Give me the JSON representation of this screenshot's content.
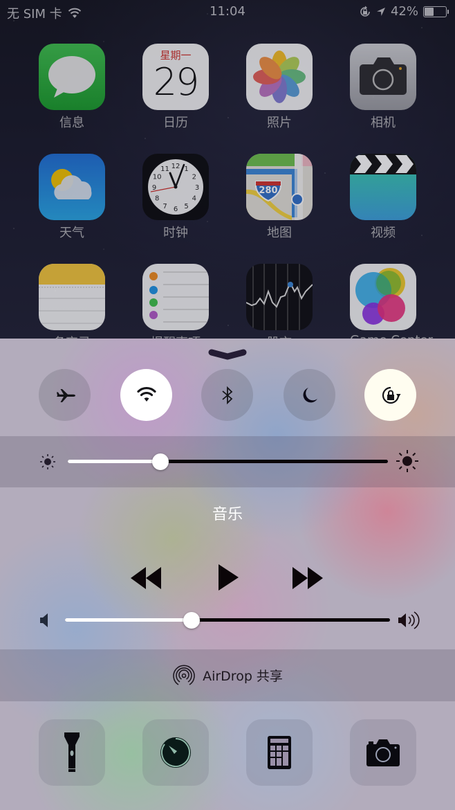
{
  "status_bar": {
    "carrier": "无 SIM 卡",
    "time": "11:04",
    "battery_percent": "42%",
    "battery_level": 0.42,
    "icons": [
      "wifi-icon",
      "rotation-lock-icon",
      "location-arrow-icon",
      "battery-icon"
    ]
  },
  "home_screen": {
    "apps": [
      {
        "name": "messages",
        "label": "信息"
      },
      {
        "name": "calendar",
        "label": "日历",
        "weekday": "星期一",
        "day": "29"
      },
      {
        "name": "photos",
        "label": "照片"
      },
      {
        "name": "camera",
        "label": "相机"
      },
      {
        "name": "weather",
        "label": "天气"
      },
      {
        "name": "clock",
        "label": "时钟",
        "numbers": [
          "12",
          "1",
          "2",
          "3",
          "4",
          "5",
          "6",
          "7",
          "8",
          "9",
          "10",
          "11"
        ]
      },
      {
        "name": "maps",
        "label": "地图",
        "highway": "280"
      },
      {
        "name": "videos",
        "label": "视频"
      },
      {
        "name": "notes",
        "label": "备忘录"
      },
      {
        "name": "reminders",
        "label": "提醒事项"
      },
      {
        "name": "stocks",
        "label": "股市"
      },
      {
        "name": "game-center",
        "label": "Game Center"
      }
    ]
  },
  "control_center": {
    "toggles": [
      {
        "name": "airplane-mode",
        "icon": "airplane-icon",
        "on": false
      },
      {
        "name": "wifi",
        "icon": "wifi-icon",
        "on": true
      },
      {
        "name": "bluetooth",
        "icon": "bluetooth-icon",
        "on": false
      },
      {
        "name": "do-not-disturb",
        "icon": "moon-icon",
        "on": false
      },
      {
        "name": "rotation-lock",
        "icon": "rotation-lock-icon",
        "on": true
      }
    ],
    "brightness": {
      "value": 0.29,
      "min_icon": "sun-small-icon",
      "max_icon": "sun-large-icon"
    },
    "music": {
      "title": "音乐",
      "controls": [
        "rewind-icon",
        "play-icon",
        "fast-forward-icon"
      ],
      "volume": {
        "value": 0.39,
        "min_icon": "speaker-icon",
        "max_icon": "speaker-loud-icon"
      }
    },
    "airdrop": {
      "label": "AirDrop 共享",
      "icon": "airdrop-icon"
    },
    "tools": [
      {
        "name": "flashlight",
        "icon": "flashlight-icon"
      },
      {
        "name": "timer",
        "icon": "timer-icon"
      },
      {
        "name": "calculator",
        "icon": "calculator-icon"
      },
      {
        "name": "camera",
        "icon": "camera-icon"
      }
    ]
  }
}
